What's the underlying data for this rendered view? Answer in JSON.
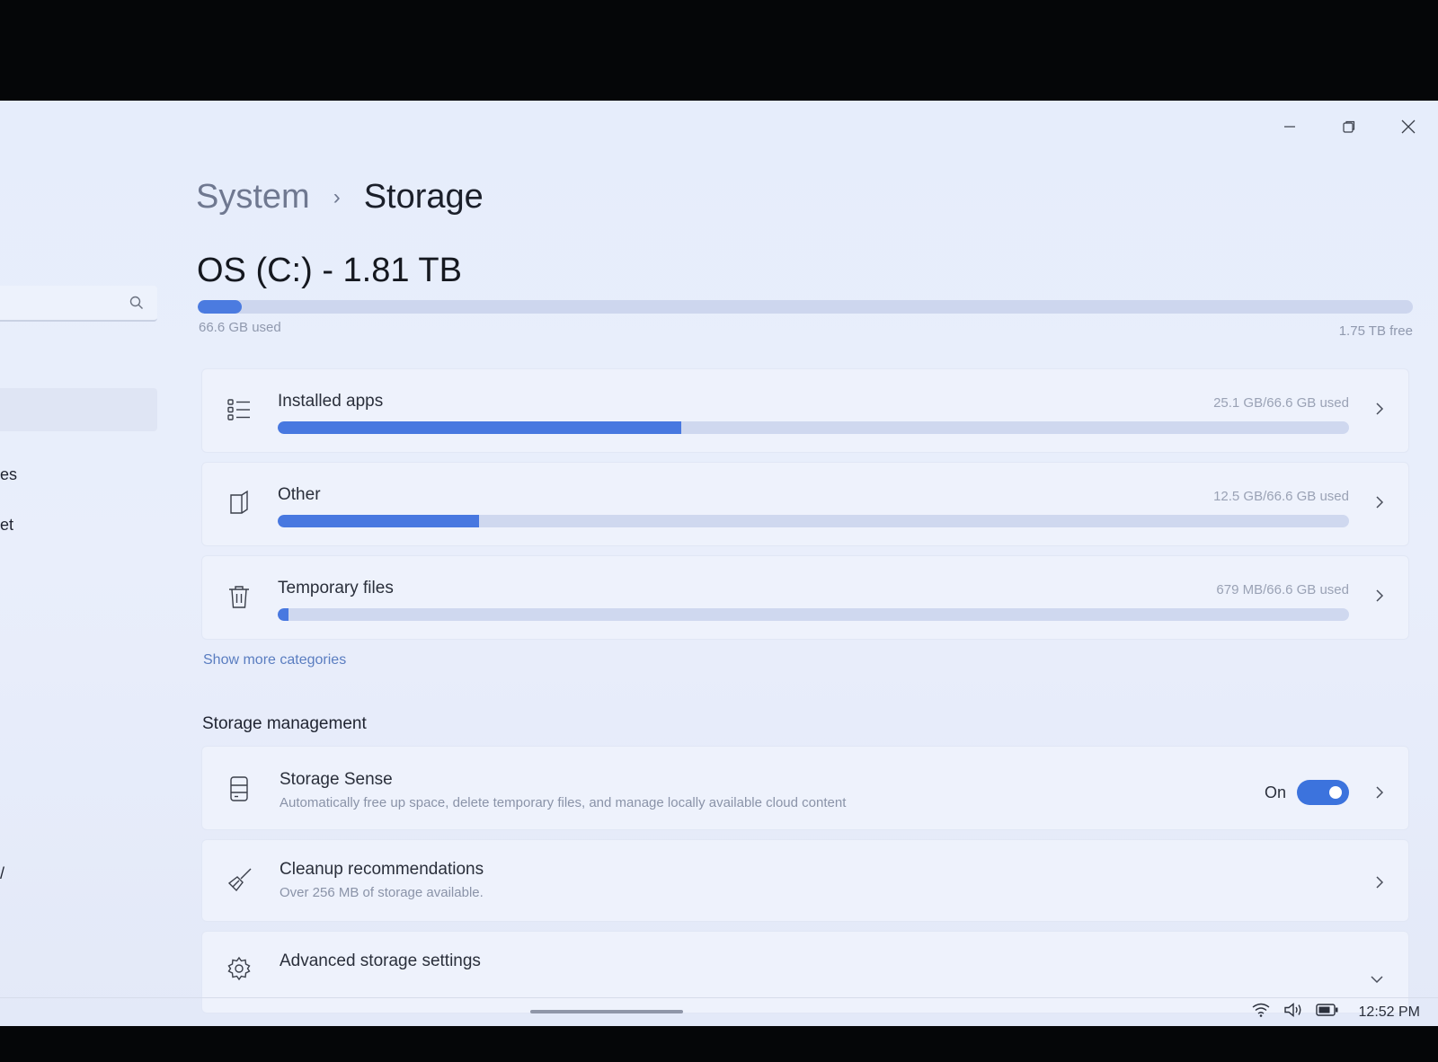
{
  "window": {
    "minimize_icon": "minimize-icon",
    "restore_icon": "restore-icon",
    "close_icon": "close-icon"
  },
  "sidebar": {
    "search_icon": "search-icon",
    "fragments": [
      "es",
      "et",
      "/"
    ]
  },
  "breadcrumb": {
    "parent": "System",
    "separator": "›",
    "current": "Storage"
  },
  "drive": {
    "title": "OS (C:) - 1.81 TB",
    "used_label": "66.6 GB used",
    "free_label": "1.75 TB free",
    "used_fraction": 0.036,
    "accent_color": "#4b7be0"
  },
  "categories": [
    {
      "label": "Installed apps",
      "usage": "25.1 GB/66.6 GB used",
      "fraction": 0.377,
      "icon": "list-icon"
    },
    {
      "label": "Other",
      "usage": "12.5 GB/66.6 GB used",
      "fraction": 0.188,
      "icon": "document-icon"
    },
    {
      "label": "Temporary files",
      "usage": "679 MB/66.6 GB used",
      "fraction": 0.01,
      "icon": "trash-icon"
    }
  ],
  "show_more": "Show more categories",
  "management": {
    "title": "Storage management",
    "items": [
      {
        "title": "Storage Sense",
        "desc": "Automatically free up space, delete temporary files, and manage locally available cloud content",
        "toggle_label": "On",
        "toggle_on": true,
        "icon": "drive-icon"
      },
      {
        "title": "Cleanup recommendations",
        "desc": "Over 256 MB of storage available.",
        "icon": "broom-icon"
      },
      {
        "title": "Advanced storage settings",
        "desc": "",
        "icon": "gear-icon"
      }
    ]
  },
  "taskbar": {
    "time": "12:52 PM",
    "wifi_icon": "wifi-icon",
    "volume_icon": "volume-icon",
    "battery_icon": "battery-icon"
  }
}
